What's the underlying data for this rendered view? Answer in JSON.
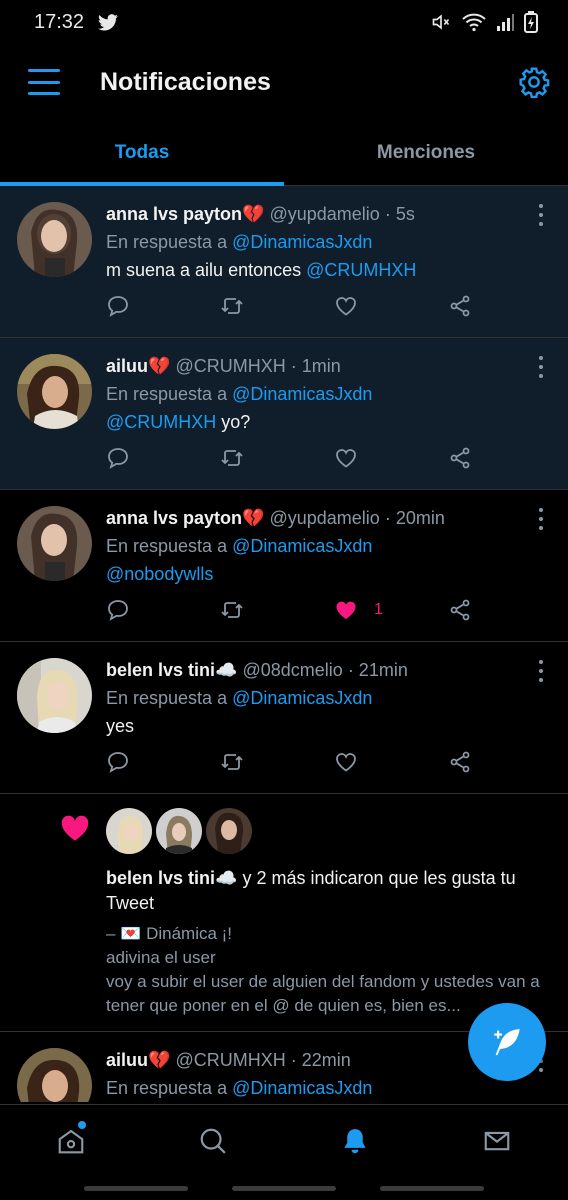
{
  "status_bar": {
    "time": "17:32"
  },
  "header": {
    "title": "Notificaciones"
  },
  "tabs": [
    {
      "label": "Todas",
      "active": true
    },
    {
      "label": "Menciones",
      "active": false
    }
  ],
  "tweets": [
    {
      "name": "anna lvs payton",
      "emoji": "💔",
      "handle": "@yupdamelio",
      "time": "· 5s",
      "reply_prefix": "En respuesta a",
      "reply_to": "@DinamicasJxdn",
      "text_before": "m suena a ailu entonces",
      "text_mention": "@CRUMHXH",
      "text_after": ""
    },
    {
      "name": "ailuu",
      "emoji": "💔",
      "handle": "@CRUMHXH",
      "time": "· 1min",
      "reply_prefix": "En respuesta a",
      "reply_to": "@DinamicasJxdn",
      "text_before": "",
      "text_mention": "@CRUMHXH",
      "text_after": " yo?"
    },
    {
      "name": "anna lvs payton",
      "emoji": "💔",
      "handle": "@yupdamelio",
      "time": "· 20min",
      "reply_prefix": "En respuesta a",
      "reply_to": "@DinamicasJxdn",
      "text_before": "",
      "text_mention": "@nobodywlls",
      "text_after": "",
      "like_count": "1"
    },
    {
      "name": "belen lvs tini",
      "emoji": "☁️",
      "handle": "@08dcmelio",
      "time": "· 21min",
      "reply_prefix": "En respuesta a",
      "reply_to": "@DinamicasJxdn",
      "text_before": "yes",
      "text_mention": "",
      "text_after": ""
    }
  ],
  "like_notification": {
    "name": "belen lvs tini",
    "emoji": "☁️",
    "rest": " y 2 más indicaron que les gusta tu Tweet",
    "line1": "– 💌 Dinámica ¡!",
    "line2": "adivina el user",
    "line3": "voy a subir el user de alguien del fandom y ustedes van a tener que poner en el @ de quien es, bien es..."
  },
  "partial_tweet": {
    "name": "ailuu",
    "emoji": "💔",
    "handle": "@CRUMHXH",
    "time": "· 22min",
    "reply_prefix": "En respuesta a",
    "reply_to": "@DinamicasJxdn"
  },
  "colors": {
    "accent": "#1d9bf0",
    "like": "#f91880",
    "unread_bg": "#0f1e2a",
    "secondary_text": "#8b98a5"
  }
}
